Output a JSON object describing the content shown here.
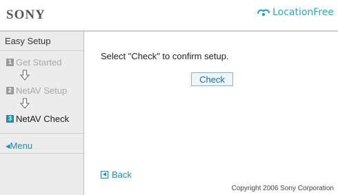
{
  "header": {
    "brand": "SONY",
    "logo_text": "LocationFree",
    "logo_icon": "locationfree-logo-icon"
  },
  "sidebar": {
    "title": "Easy Setup",
    "steps": [
      {
        "number": "1",
        "label": "Get Started",
        "state": "inactive"
      },
      {
        "number": "2",
        "label": "NetAV Setup",
        "state": "inactive"
      },
      {
        "number": "3",
        "label": "NetAV Check",
        "state": "active"
      }
    ],
    "menu_label": "◂Menu"
  },
  "main": {
    "instruction": "Select \"Check\" to confirm setup.",
    "check_label": "Check",
    "back_label": "Back"
  },
  "footer": {
    "copyright": "Copyright 2006 Sony Corporation"
  },
  "colors": {
    "accent": "#1b8fb2",
    "logo": "#2aa7c4",
    "sidebar_bg": "#ececec"
  }
}
